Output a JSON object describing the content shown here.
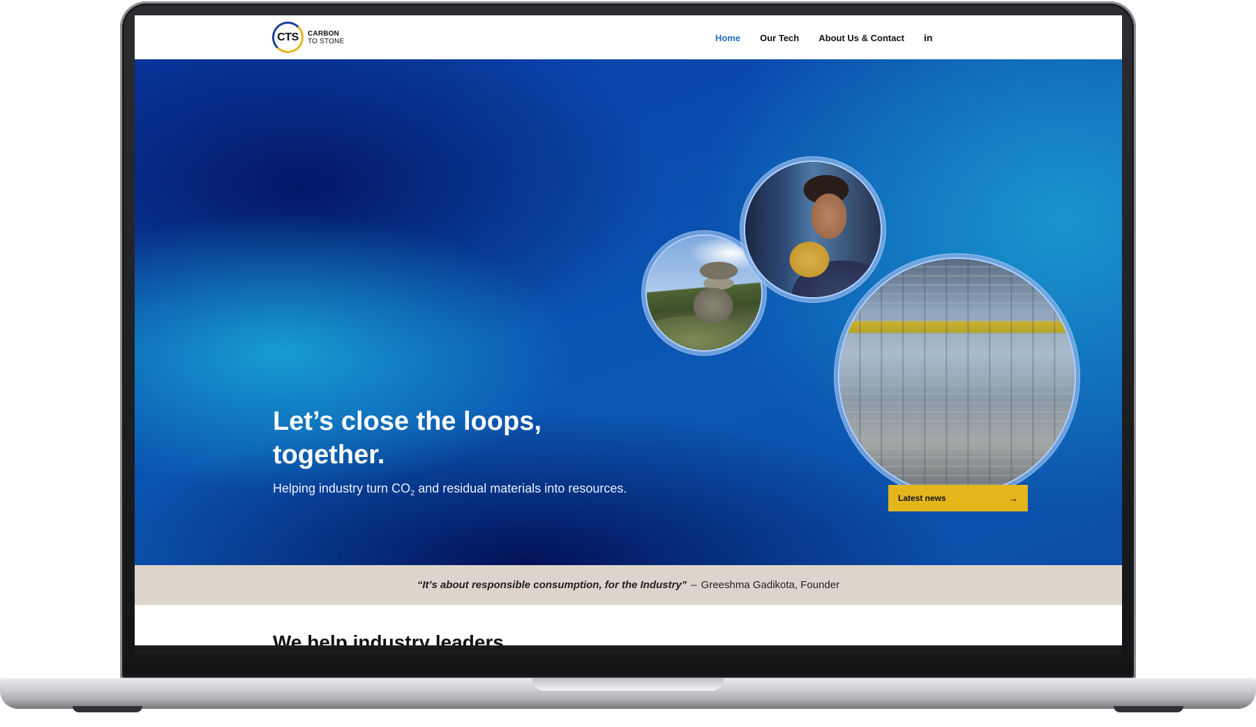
{
  "brand": {
    "logo_mark": "CTS",
    "name_line1": "CARBON",
    "name_line2": "TO STONE"
  },
  "nav": {
    "items": [
      {
        "label": "Home",
        "active": true
      },
      {
        "label": "Our Tech",
        "active": false
      },
      {
        "label": "About Us & Contact",
        "active": false
      }
    ],
    "social_icon": "linkedin-icon",
    "social_label": "in"
  },
  "hero": {
    "title": "Let’s close the loops, together.",
    "subtitle_pre": "Helping industry turn CO",
    "subtitle_sub": "2",
    "subtitle_post": " and residual materials into resources.",
    "images": [
      "mountain-cairn-photo",
      "scientist-photo",
      "factory-warehouse-photo"
    ],
    "cta_label": "Latest news",
    "cta_icon": "arrow-right-icon",
    "cta_arrow": "→"
  },
  "quote": {
    "text": "“It’s about responsible consumption, for the Industry”",
    "dash": "–",
    "author": "Greeshma Gadikota, Founder"
  },
  "section": {
    "title": "We help industry leaders"
  },
  "colors": {
    "accent_blue": "#1d6fc4",
    "cta_yellow": "#e5b51c",
    "quote_band": "#ddd5cc",
    "hero_deep": "#0a3aa6"
  }
}
